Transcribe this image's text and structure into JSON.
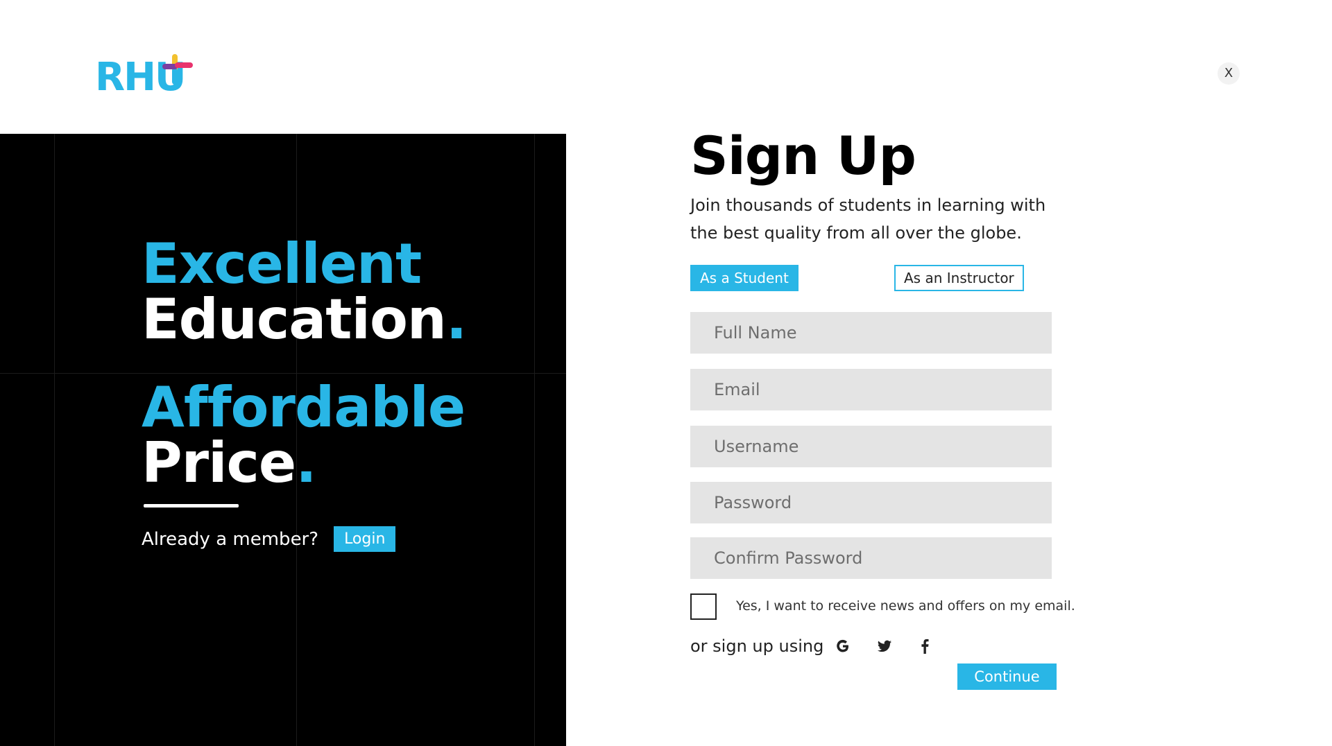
{
  "brand": {
    "logo_text": "RHU",
    "accent_color": "#29b6e6"
  },
  "close_label": "X",
  "hero": {
    "line1": "Excellent",
    "line2": "Education",
    "line3": "Affordable",
    "line4": "Price",
    "dot": ".",
    "member_text": "Already a member?",
    "login_label": "Login"
  },
  "form": {
    "title": "Sign Up",
    "subtitle": "Join thousands of students in learning with the best quality from all over the globe.",
    "roles": {
      "student_label": "As a Student",
      "instructor_label": "As an Instructor",
      "selected": "student"
    },
    "fields": {
      "full_name_placeholder": "Full Name",
      "email_placeholder": "Email",
      "username_placeholder": "Username",
      "password_placeholder": "Password",
      "confirm_password_placeholder": "Confirm Password"
    },
    "newsletter_label": "Yes, I want to receive news and offers on my email.",
    "newsletter_checked": false,
    "social_text": "or sign up using",
    "social_icons": [
      "google-icon",
      "twitter-icon",
      "facebook-icon"
    ],
    "continue_label": "Continue"
  }
}
